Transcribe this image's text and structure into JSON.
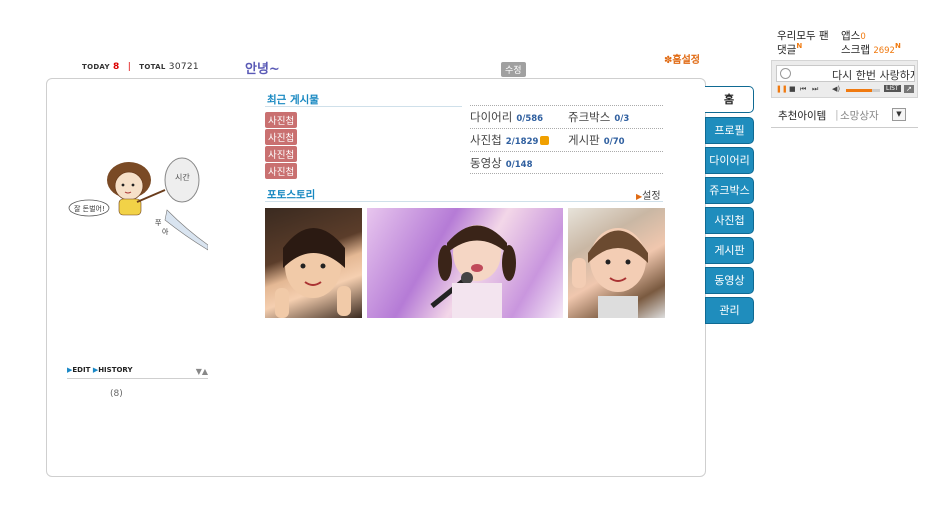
{
  "header": {
    "today_label": "TODAY",
    "today_value": "8",
    "total_label": "TOTAL",
    "total_value": "30721",
    "title": "안녕~",
    "edit_label": "수정",
    "home_setting": "홈설정"
  },
  "profile": {
    "image_desc": "caricature",
    "edit_label": "EDIT",
    "history_label": "HISTORY",
    "history_count": "(8)"
  },
  "recent": {
    "title": "최근 게시물",
    "tags": [
      "사진첩",
      "사진첩",
      "사진첩",
      "사진첩"
    ],
    "stats": [
      {
        "label": "다이어리",
        "value": "0/586"
      },
      {
        "label": "쥬크박스",
        "value": "0/3"
      },
      {
        "label": "사진첩",
        "value": "2/1829"
      },
      {
        "label": "게시판",
        "value": "0/70"
      },
      {
        "label": "동영상",
        "value": "0/148"
      }
    ]
  },
  "photostory": {
    "title": "포토스토리",
    "setting": "설정"
  },
  "tabs": [
    "홈",
    "프로필",
    "다이어리",
    "쥬크박스",
    "사진첩",
    "게시판",
    "동영상",
    "관리"
  ],
  "right_panel": {
    "line1_a": "우리모두 팬",
    "line1_b": "앱스",
    "line1_b_count": "0",
    "line2_a": "댓글",
    "line2_b": "스크랩",
    "line2_b_count": "2692",
    "new_badge": "N",
    "player": {
      "song": "다시 한번 사랑하지",
      "list_label": "LIST",
      "volume": 0.75
    },
    "recommend_label": "추천아이템",
    "wish_label": "소망상자"
  },
  "colors": {
    "accent": "#1f8dbd",
    "orange": "#f07a10",
    "tag": "#c97070"
  }
}
